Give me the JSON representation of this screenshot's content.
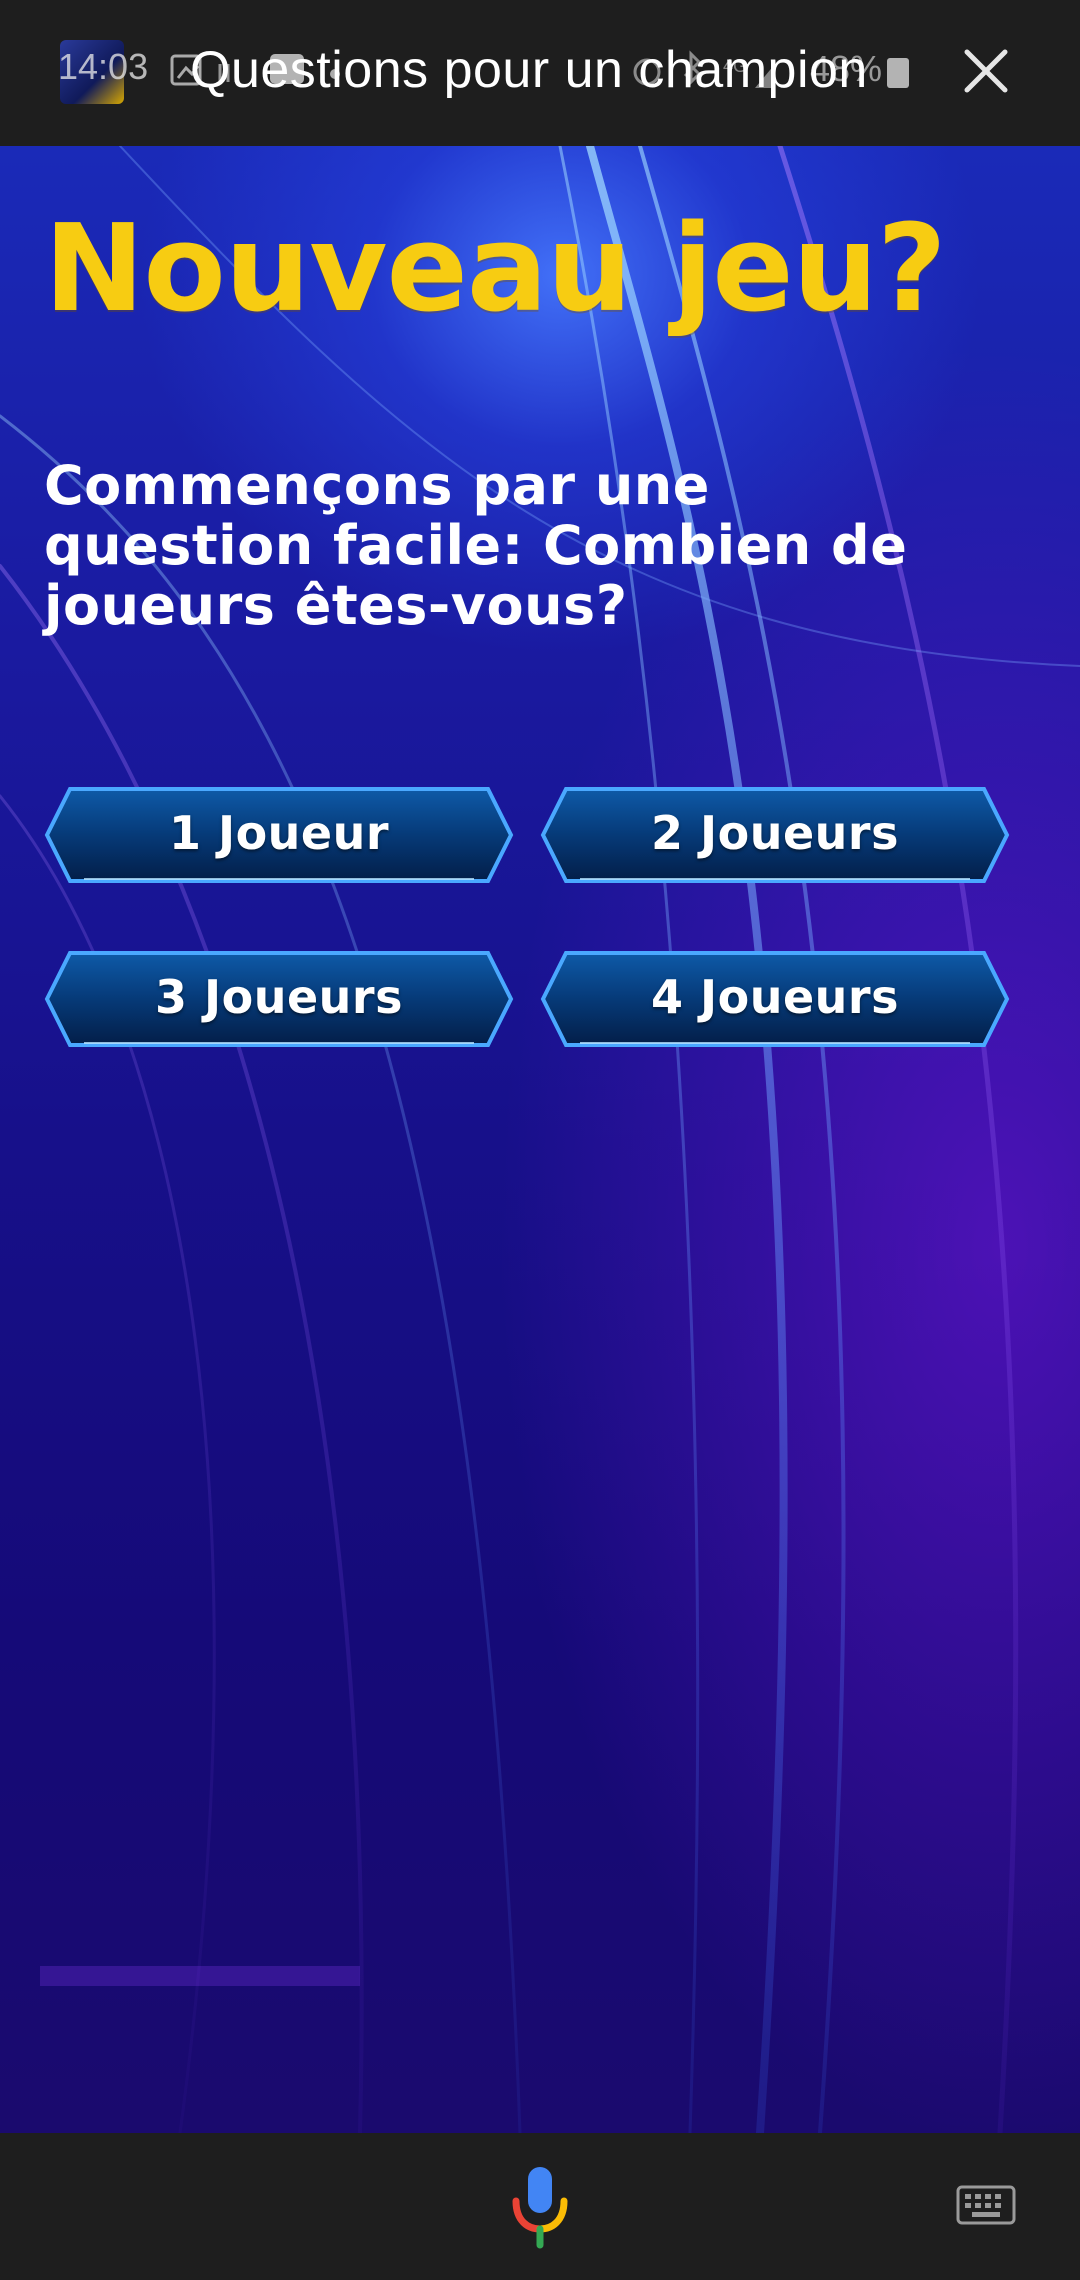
{
  "status_bar": {
    "time": "14:03",
    "battery": "48%"
  },
  "header": {
    "app_title": "Questions pour un champion",
    "close_icon": "close-icon"
  },
  "game": {
    "title": "Nouveau jeu?",
    "question": "Commençons par une question facile: Combien de joueurs êtes-vous?",
    "answers": [
      {
        "label": "1 Joueur"
      },
      {
        "label": "2 Joueurs"
      },
      {
        "label": "3 Joueurs"
      },
      {
        "label": "4 Joueurs"
      }
    ]
  },
  "bottom_bar": {
    "mic_icon": "microphone-icon",
    "keyboard_icon": "keyboard-icon"
  },
  "colors": {
    "title_yellow": "#f7cc12",
    "button_border": "#4aa8ff",
    "button_fill": "#063a78",
    "bar_background": "#1e1e1e"
  }
}
